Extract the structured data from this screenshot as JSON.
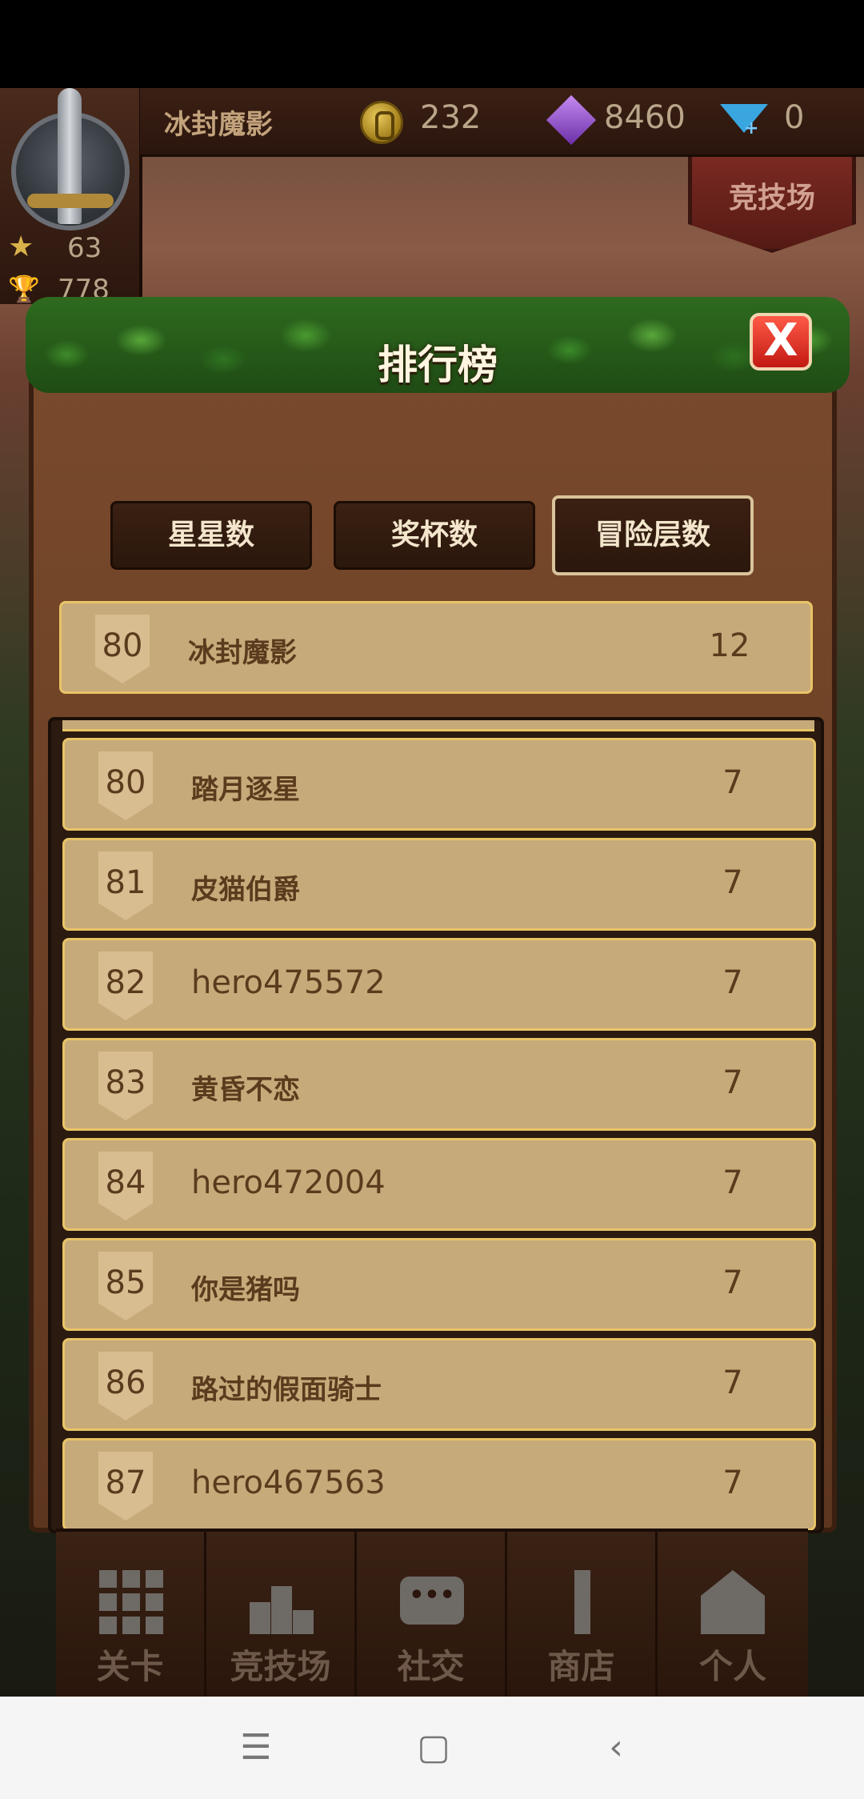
{
  "hud": {
    "player_name": "冰封魔影",
    "gold": "232",
    "gems": "8460",
    "diamonds": "0",
    "stars": "63",
    "trophies": "778",
    "arena_label": "竞技场"
  },
  "leaderboard": {
    "title": "排行榜",
    "close_symbol": "X",
    "tabs": [
      {
        "label": "星星数",
        "active": false
      },
      {
        "label": "奖杯数",
        "active": false
      },
      {
        "label": "冒险层数",
        "active": true
      }
    ],
    "my_entry": {
      "rank": "80",
      "name": "冰封魔影",
      "score": "12"
    },
    "entries": [
      {
        "rank": "80",
        "name": "踏月逐星",
        "score": "7"
      },
      {
        "rank": "81",
        "name": "皮猫伯爵",
        "score": "7"
      },
      {
        "rank": "82",
        "name": "hero475572",
        "score": "7"
      },
      {
        "rank": "83",
        "name": "黄昏不恋",
        "score": "7"
      },
      {
        "rank": "84",
        "name": "hero472004",
        "score": "7"
      },
      {
        "rank": "85",
        "name": "你是猪吗",
        "score": "7"
      },
      {
        "rank": "86",
        "name": "路过的假面骑士",
        "score": "7"
      },
      {
        "rank": "87",
        "name": "hero467563",
        "score": "7"
      }
    ]
  },
  "nav": [
    {
      "label": "关卡",
      "icon": "grid-icon"
    },
    {
      "label": "竞技场",
      "icon": "podium-icon"
    },
    {
      "label": "社交",
      "icon": "chat-icon"
    },
    {
      "label": "商店",
      "icon": "shop-icon"
    },
    {
      "label": "个人",
      "icon": "home-icon"
    }
  ],
  "system_nav": {
    "menu": "☰",
    "home": "▢",
    "back": "‹"
  }
}
